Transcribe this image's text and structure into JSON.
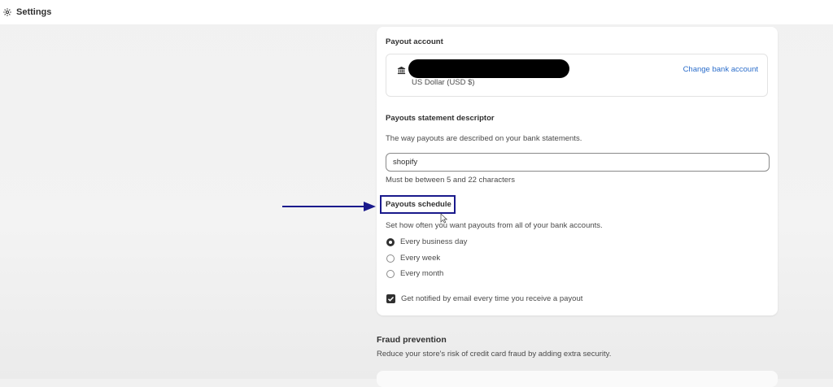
{
  "topbar": {
    "title": "Settings",
    "icon": "gear-icon"
  },
  "payout_account": {
    "heading": "Payout account",
    "currency": "US Dollar (USD $)",
    "change_link": "Change bank account",
    "icon": "bank-icon"
  },
  "descriptor": {
    "heading": "Payouts statement descriptor",
    "help": "The way payouts are described on your bank statements.",
    "value": "shopify",
    "hint": "Must be between 5 and 22 characters"
  },
  "schedule": {
    "heading": "Payouts schedule",
    "help": "Set how often you want payouts from all of your bank accounts.",
    "options": [
      {
        "label": "Every business day",
        "checked": true
      },
      {
        "label": "Every week",
        "checked": false
      },
      {
        "label": "Every month",
        "checked": false
      }
    ],
    "notify_label": "Get notified by email every time you receive a payout",
    "notify_checked": true
  },
  "fraud": {
    "heading": "Fraud prevention",
    "description": "Reduce your store's risk of credit card fraud by adding extra security."
  },
  "colors": {
    "accent_link": "#2c6ecb",
    "highlight_box": "#1a1a8c"
  }
}
